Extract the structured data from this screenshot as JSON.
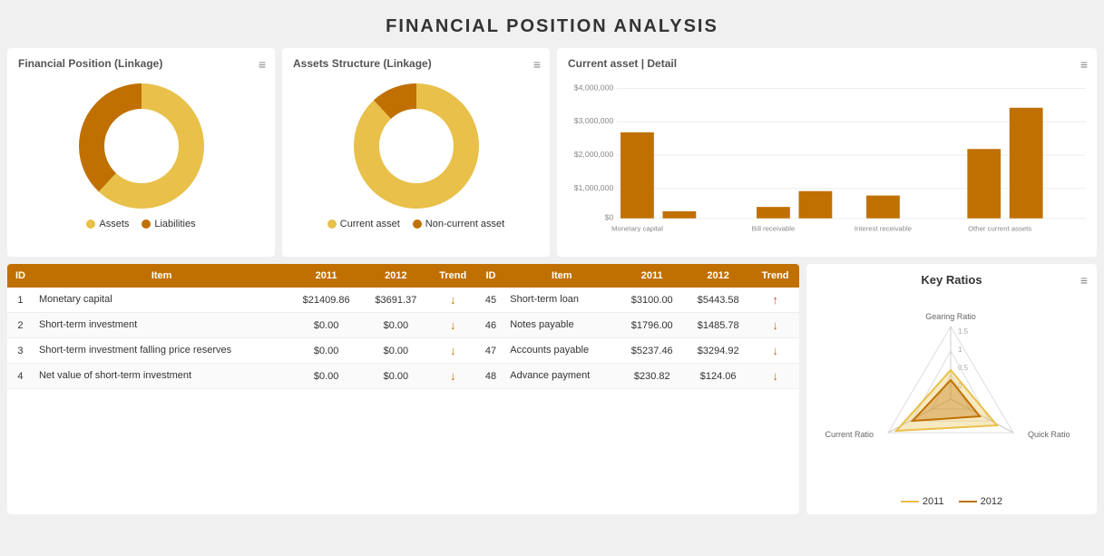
{
  "title": "FINANCIAL POSITION ANALYSIS",
  "charts": {
    "fp": {
      "title": "Financial Position (Linkage)",
      "legend": [
        {
          "label": "Assets",
          "color": "#e8c04a"
        },
        {
          "label": "Liabilities",
          "color": "#c07000"
        }
      ],
      "donut": {
        "assets_pct": 0.62,
        "liabilities_pct": 0.38
      }
    },
    "as": {
      "title": "Assets Structure (Linkage)",
      "legend": [
        {
          "label": "Current asset",
          "color": "#e8c04a"
        },
        {
          "label": "Non-current asset",
          "color": "#c07000"
        }
      ],
      "donut": {
        "current_pct": 0.88,
        "noncurrent_pct": 0.12
      }
    },
    "ca": {
      "title": "Current asset | Detail",
      "y_labels": [
        "$0",
        "$1,000,000",
        "$2,000,000",
        "$3,000,000",
        "$4,000,000"
      ],
      "bars": [
        {
          "label": "Monetary capital",
          "value": 2650000,
          "max": 4000000
        },
        {
          "label": "",
          "value": 200000,
          "max": 4000000
        },
        {
          "label": "",
          "value": 0,
          "max": 4000000
        },
        {
          "label": "Bill receivable",
          "value": 350000,
          "max": 4000000
        },
        {
          "label": "",
          "value": 850000,
          "max": 4000000
        },
        {
          "label": "Interest receivable",
          "value": 700000,
          "max": 4000000
        },
        {
          "label": "",
          "value": 0,
          "max": 4000000
        },
        {
          "label": "Other current assets",
          "value": 2150000,
          "max": 4000000
        },
        {
          "label": "",
          "value": 3400000,
          "max": 4000000
        }
      ]
    }
  },
  "table": {
    "headers_left": [
      "ID",
      "Item",
      "2011",
      "2012",
      "Trend"
    ],
    "headers_right": [
      "ID",
      "Item",
      "2011",
      "2012",
      "Trend"
    ],
    "rows": [
      {
        "left": {
          "id": "1",
          "item": "Monetary capital",
          "v2011": "$21409.86",
          "v2012": "$3691.37",
          "trend": "down"
        },
        "right": {
          "id": "45",
          "item": "Short-term loan",
          "v2011": "$3100.00",
          "v2012": "$5443.58",
          "trend": "up"
        }
      },
      {
        "left": {
          "id": "2",
          "item": "Short-term investment",
          "v2011": "$0.00",
          "v2012": "$0.00",
          "trend": "down"
        },
        "right": {
          "id": "46",
          "item": "Notes payable",
          "v2011": "$1796.00",
          "v2012": "$1485.78",
          "trend": "down"
        }
      },
      {
        "left": {
          "id": "3",
          "item": "Short-term investment falling price reserves",
          "v2011": "$0.00",
          "v2012": "$0.00",
          "trend": "down"
        },
        "right": {
          "id": "47",
          "item": "Accounts payable",
          "v2011": "$5237.46",
          "v2012": "$3294.92",
          "trend": "down"
        }
      },
      {
        "left": {
          "id": "4",
          "item": "Net value of short-term investment",
          "v2011": "$0.00",
          "v2012": "$0.00",
          "trend": "down"
        },
        "right": {
          "id": "48",
          "item": "Advance payment",
          "v2011": "$230.82",
          "v2012": "$124.06",
          "trend": "down"
        }
      }
    ]
  },
  "key_ratios": {
    "title": "Key Ratios",
    "axes": [
      "Gearing Ratio",
      "Quick Ratio",
      "Current Ratio"
    ],
    "rings": [
      0,
      0.5,
      1,
      1.5
    ],
    "ring_labels": [
      "0",
      "0.5",
      "1",
      "1.5"
    ],
    "series": [
      {
        "label": "2011",
        "color": "#e8c04a",
        "values": [
          0.6,
          1.1,
          1.3
        ]
      },
      {
        "label": "2012",
        "color": "#c07000",
        "values": [
          0.4,
          0.7,
          0.9
        ]
      }
    ]
  }
}
